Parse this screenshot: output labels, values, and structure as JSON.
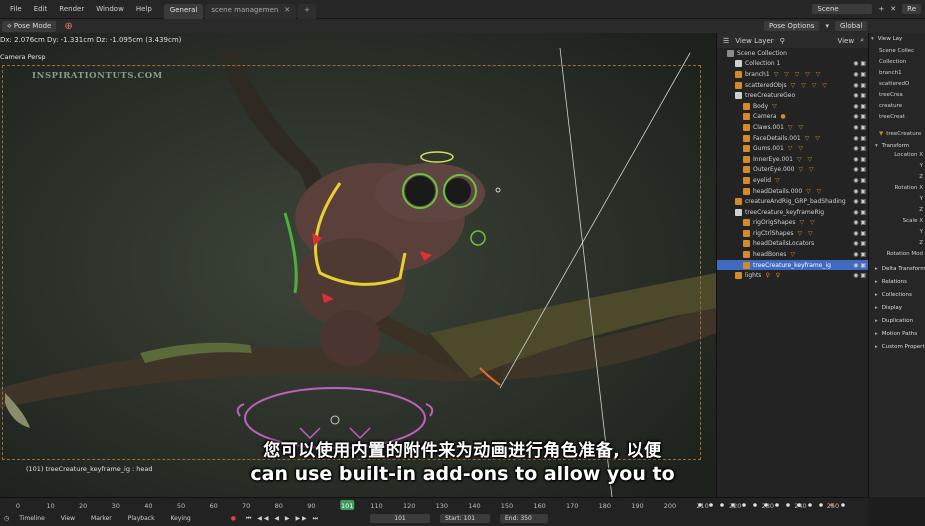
{
  "menu": [
    "File",
    "Edit",
    "Render",
    "Window",
    "Help"
  ],
  "tabs": [
    "General",
    "scene managemen"
  ],
  "scene": "Scene",
  "render_layer": "Re",
  "toolbar": {
    "mode": "Pose Mode",
    "pose_options": "Pose Options",
    "orientation": "Global"
  },
  "viewport": {
    "info": "Dx: 2.076cm  Dy: -1.331cm  Dz: -1.095cm (3.439cm)",
    "camera_label": "Camera Persp",
    "watermark": "INSPIRATIONTUTS.COM",
    "object_label": "(101) treeCreature_keyframe_ig : head"
  },
  "outliner": {
    "view_layer": "View Layer",
    "view": "View",
    "rows": [
      {
        "label": "Scene Collection",
        "indent": 0,
        "icon": "#8a8a8a",
        "tris": ""
      },
      {
        "label": "Collection 1",
        "indent": 1,
        "icon": "#cfcfcf",
        "tris": ""
      },
      {
        "label": "branch1",
        "indent": 1,
        "icon": "#d48a2a",
        "tris": "▽ ▽ ▽ ▽ ▽"
      },
      {
        "label": "scatteredObjs",
        "indent": 1,
        "icon": "#d48a2a",
        "tris": "▽ ▽ ▽ ▽"
      },
      {
        "label": "treeCreatureGeo",
        "indent": 1,
        "icon": "#cfcfcf",
        "tris": ""
      },
      {
        "label": "Body",
        "indent": 2,
        "icon": "#d48a2a",
        "tris": "▽"
      },
      {
        "label": "Camera",
        "indent": 2,
        "icon": "#d48a2a",
        "tris": "●"
      },
      {
        "label": "Claws.001",
        "indent": 2,
        "icon": "#d48a2a",
        "tris": "▽ ▽"
      },
      {
        "label": "FaceDetails.001",
        "indent": 2,
        "icon": "#d48a2a",
        "tris": "▽ ▽"
      },
      {
        "label": "Gums.001",
        "indent": 2,
        "icon": "#d48a2a",
        "tris": "▽ ▽"
      },
      {
        "label": "InnerEye.001",
        "indent": 2,
        "icon": "#d48a2a",
        "tris": "▽ ▽"
      },
      {
        "label": "OuterEye.000",
        "indent": 2,
        "icon": "#d48a2a",
        "tris": "▽ ▽"
      },
      {
        "label": "eyelid",
        "indent": 2,
        "icon": "#d48a2a",
        "tris": "▽"
      },
      {
        "label": "headDetails.000",
        "indent": 2,
        "icon": "#d48a2a",
        "tris": "▽ ▽"
      },
      {
        "label": "creatureAndRig_GRP_badShading",
        "indent": 1,
        "icon": "#d48a2a",
        "tris": ""
      },
      {
        "label": "treeCreature_keyframeRig",
        "indent": 1,
        "icon": "#cfcfcf",
        "tris": ""
      },
      {
        "label": "rigOrigShapes",
        "indent": 2,
        "icon": "#d48a2a",
        "tris": "▽ ▽"
      },
      {
        "label": "rigCtrlShapes",
        "indent": 2,
        "icon": "#d48a2a",
        "tris": "▽ ▽"
      },
      {
        "label": "headDetailsLocators",
        "indent": 2,
        "icon": "#d48a2a",
        "tris": ""
      },
      {
        "label": "headBones",
        "indent": 2,
        "icon": "#d48a2a",
        "tris": "▽"
      },
      {
        "label": "treeCreature_keyframe_ig",
        "indent": 2,
        "icon": "#d48a2a",
        "tris": "",
        "selected": true
      },
      {
        "label": "lights",
        "indent": 1,
        "icon": "#d48a2a",
        "tris": "♀ ♀"
      }
    ]
  },
  "outliner2": {
    "view_layer": "View Lay",
    "rows": [
      "Scene Collec",
      "Collection",
      "branch1",
      "scatteredO",
      "treeCrea",
      "creature",
      "treeCreat"
    ]
  },
  "properties": {
    "object": "treeCreature",
    "transform": "Transform",
    "rows": [
      "Location X",
      "Y",
      "Z",
      "Rotation X",
      "Y",
      "Z",
      "Scale X",
      "Y",
      "Z",
      "Rotation Mod"
    ],
    "sections": [
      "Delta Transform",
      "Relations",
      "Collections",
      "Display",
      "Duplication",
      "Motion Paths",
      "Custom Propert"
    ]
  },
  "timeline": {
    "ticks": [
      "0",
      "10",
      "20",
      "30",
      "40",
      "50",
      "60",
      "70",
      "80",
      "90",
      "101",
      "110",
      "120",
      "130",
      "140",
      "150",
      "160",
      "170",
      "180",
      "190",
      "200",
      "210",
      "220",
      "230",
      "240",
      "250"
    ],
    "current_frame": "101",
    "menu": [
      "Timeline",
      "View",
      "Marker",
      "Playback",
      "Keying"
    ],
    "start_label": "Start:",
    "start": "101",
    "end_label": "End:",
    "end": "350"
  },
  "subtitles": {
    "zh": "您可以使用内置的附件来为动画进行角色准备, 以便",
    "en": "can use built-in add-ons to allow you to"
  },
  "colors": {
    "accent": "#d48a2a",
    "selection": "#3f6ac0",
    "current_frame": "#3e9b5a"
  }
}
